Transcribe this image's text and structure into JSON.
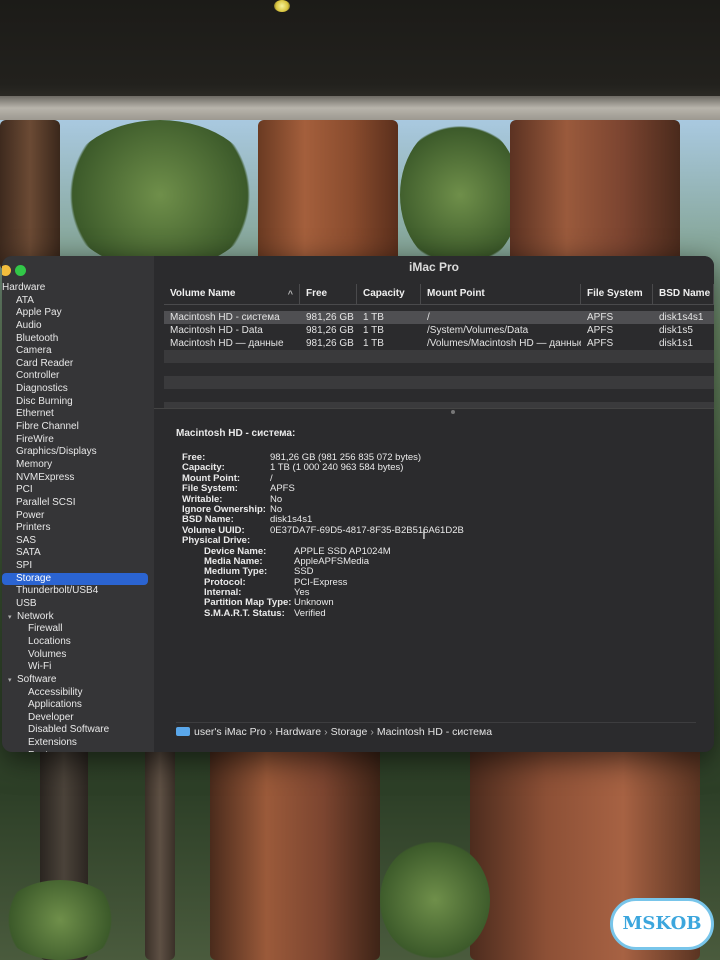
{
  "window": {
    "title": "iMac Pro"
  },
  "sidebar": {
    "items": [
      {
        "label": "Hardware",
        "level": 0,
        "expanded": true,
        "selected": false
      },
      {
        "label": "ATA",
        "level": 1,
        "selected": false
      },
      {
        "label": "Apple Pay",
        "level": 1,
        "selected": false
      },
      {
        "label": "Audio",
        "level": 1,
        "selected": false
      },
      {
        "label": "Bluetooth",
        "level": 1,
        "selected": false
      },
      {
        "label": "Camera",
        "level": 1,
        "selected": false
      },
      {
        "label": "Card Reader",
        "level": 1,
        "selected": false
      },
      {
        "label": "Controller",
        "level": 1,
        "selected": false
      },
      {
        "label": "Diagnostics",
        "level": 1,
        "selected": false
      },
      {
        "label": "Disc Burning",
        "level": 1,
        "selected": false
      },
      {
        "label": "Ethernet",
        "level": 1,
        "selected": false
      },
      {
        "label": "Fibre Channel",
        "level": 1,
        "selected": false
      },
      {
        "label": "FireWire",
        "level": 1,
        "selected": false
      },
      {
        "label": "Graphics/Displays",
        "level": 1,
        "selected": false
      },
      {
        "label": "Memory",
        "level": 1,
        "selected": false
      },
      {
        "label": "NVMExpress",
        "level": 1,
        "selected": false
      },
      {
        "label": "PCI",
        "level": 1,
        "selected": false
      },
      {
        "label": "Parallel SCSI",
        "level": 1,
        "selected": false
      },
      {
        "label": "Power",
        "level": 1,
        "selected": false
      },
      {
        "label": "Printers",
        "level": 1,
        "selected": false
      },
      {
        "label": "SAS",
        "level": 1,
        "selected": false
      },
      {
        "label": "SATA",
        "level": 1,
        "selected": false
      },
      {
        "label": "SPI",
        "level": 1,
        "selected": false
      },
      {
        "label": "Storage",
        "level": 1,
        "selected": true
      },
      {
        "label": "Thunderbolt/USB4",
        "level": 1,
        "selected": false
      },
      {
        "label": "USB",
        "level": 1,
        "selected": false
      },
      {
        "label": "Network",
        "level": 0,
        "expanded": true,
        "selected": false
      },
      {
        "label": "Firewall",
        "level": 1,
        "selected": false
      },
      {
        "label": "Locations",
        "level": 1,
        "selected": false
      },
      {
        "label": "Volumes",
        "level": 1,
        "selected": false
      },
      {
        "label": "Wi-Fi",
        "level": 1,
        "selected": false
      },
      {
        "label": "Software",
        "level": 0,
        "expanded": true,
        "selected": false
      },
      {
        "label": "Accessibility",
        "level": 1,
        "selected": false
      },
      {
        "label": "Applications",
        "level": 1,
        "selected": false
      },
      {
        "label": "Developer",
        "level": 1,
        "selected": false
      },
      {
        "label": "Disabled Software",
        "level": 1,
        "selected": false
      },
      {
        "label": "Extensions",
        "level": 1,
        "selected": false
      },
      {
        "label": "Fonts",
        "level": 1,
        "selected": false
      }
    ]
  },
  "volumes": {
    "columns": [
      "Volume Name",
      "Free",
      "Capacity",
      "Mount Point",
      "File System",
      "BSD Name"
    ],
    "sort_indicator": "^",
    "rows": [
      {
        "name": "Macintosh HD - система",
        "free": "981,26 GB",
        "capacity": "1 TB",
        "mount": "/",
        "fs": "APFS",
        "bsd": "disk1s4s1",
        "selected": true
      },
      {
        "name": "Macintosh HD - Data",
        "free": "981,26 GB",
        "capacity": "1 TB",
        "mount": "/System/Volumes/Data",
        "fs": "APFS",
        "bsd": "disk1s5",
        "selected": false
      },
      {
        "name": "Macintosh HD — данные",
        "free": "981,26 GB",
        "capacity": "1 TB",
        "mount": "/Volumes/Macintosh HD — данные",
        "fs": "APFS",
        "bsd": "disk1s1",
        "selected": false
      }
    ]
  },
  "details": {
    "heading": "Macintosh HD - система:",
    "fields": [
      {
        "label": "Free:",
        "value": "981,26 GB (981 256 835 072 bytes)",
        "sub": false
      },
      {
        "label": "Capacity:",
        "value": "1 TB (1 000 240 963 584 bytes)",
        "sub": false
      },
      {
        "label": "Mount Point:",
        "value": "/",
        "sub": false
      },
      {
        "label": "File System:",
        "value": "APFS",
        "sub": false
      },
      {
        "label": "Writable:",
        "value": "No",
        "sub": false
      },
      {
        "label": "Ignore Ownership:",
        "value": "No",
        "sub": false
      },
      {
        "label": "BSD Name:",
        "value": "disk1s4s1",
        "sub": false
      },
      {
        "label": "Volume UUID:",
        "value": "0E37DA7F-69D5-4817-8F35-B2B516A61D2B",
        "sub": false
      },
      {
        "label": "Physical Drive:",
        "value": "",
        "sub": false
      },
      {
        "label": "Device Name:",
        "value": "APPLE SSD AP1024M",
        "sub": true
      },
      {
        "label": "Media Name:",
        "value": "AppleAPFSMedia",
        "sub": true
      },
      {
        "label": "Medium Type:",
        "value": "SSD",
        "sub": true
      },
      {
        "label": "Protocol:",
        "value": "PCI-Express",
        "sub": true
      },
      {
        "label": "Internal:",
        "value": "Yes",
        "sub": true
      },
      {
        "label": "Partition Map Type:",
        "value": "Unknown",
        "sub": true
      },
      {
        "label": "S.M.A.R.T. Status:",
        "value": "Verified",
        "sub": true
      }
    ]
  },
  "pathbar": {
    "crumbs": [
      "user's iMac Pro",
      "Hardware",
      "Storage",
      "Macintosh HD - система"
    ],
    "separator": "›"
  },
  "watermark": {
    "text": "MSKOB"
  },
  "colors": {
    "selection": "#2b64d1",
    "close": "#f2bd3c",
    "zoom": "#32c748"
  },
  "icons": {
    "computer": "computer-icon",
    "disclosure": "disclosure-triangle-icon"
  }
}
